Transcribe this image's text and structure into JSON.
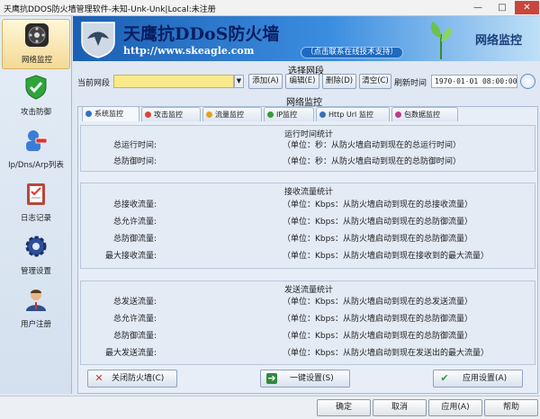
{
  "window": {
    "title": "天鹰抗DDOS防火墙管理软件-未知-Unk-Unk|Local:未注册",
    "min": "—",
    "max": "□",
    "close": "✕"
  },
  "sidebar": {
    "items": [
      {
        "label": "网络监控",
        "icon": "network-monitor-icon"
      },
      {
        "label": "攻击防御",
        "icon": "shield-check-icon"
      },
      {
        "label": "Ip/Dns/Arp列表",
        "icon": "list-user-icon"
      },
      {
        "label": "日志记录",
        "icon": "clipboard-log-icon"
      },
      {
        "label": "管理设置",
        "icon": "gear-icon"
      },
      {
        "label": "用户注册",
        "icon": "user-register-icon"
      }
    ]
  },
  "banner": {
    "name": "天鹰抗DDoS防火墙",
    "url": "http://www.skeagle.com",
    "slogan": "（点击联系在线技术支持）",
    "section": "网络监控"
  },
  "select": {
    "group_title": "选择网段",
    "label": "当前网段",
    "value": "",
    "add": "添加(A)",
    "edit": "编辑(E)",
    "delete": "删除(D)",
    "clear": "清空(C)",
    "refresh_label": "刷新时间",
    "refresh_value": "1970-01-01 08:00:00"
  },
  "monitor": {
    "group_title": "网络监控",
    "tabs": [
      {
        "label": "系统监控",
        "color": "#2f74c8"
      },
      {
        "label": "攻击监控",
        "color": "#d8453a"
      },
      {
        "label": "流量监控",
        "color": "#e6a21a"
      },
      {
        "label": "IP监控",
        "color": "#3a9a3a"
      },
      {
        "label": "Http Url 监控",
        "color": "#3a6fb8"
      },
      {
        "label": "包数据监控",
        "color": "#c23a8a"
      }
    ],
    "runtime": {
      "title": "运行时间统计",
      "rows": [
        {
          "key": "总运行时间:",
          "value": "（单位：秒：从防火墙启动到现在的总运行时间）"
        },
        {
          "key": "总防御时间:",
          "value": "（单位：秒：从防火墙启动到现在的总防御时间）"
        }
      ]
    },
    "receive": {
      "title": "接收流量统计",
      "rows": [
        {
          "key": "总接收流量:",
          "value": "（单位：Kbps：从防火墙启动到现在的总接收流量）"
        },
        {
          "key": "总允许流量:",
          "value": "（单位：Kbps：从防火墙启动到现在的总防御流量）"
        },
        {
          "key": "总防御流量:",
          "value": "（单位：Kbps：从防火墙启动到现在的总防御流量）"
        },
        {
          "key": "最大接收流量:",
          "value": "（单位：Kbps：从防火墙启动到现在接收到的最大流量）"
        }
      ]
    },
    "send": {
      "title": "发送流量统计",
      "rows": [
        {
          "key": "总发送流量:",
          "value": "（单位：Kbps：从防火墙启动到现在的总发送流量）"
        },
        {
          "key": "总允许流量:",
          "value": "（单位：Kbps：从防火墙启动到现在的总防御流量）"
        },
        {
          "key": "总防御流量:",
          "value": "（单位：Kbps：从防火墙启动到现在的总防御流量）"
        },
        {
          "key": "最大发送流量:",
          "value": "（单位：Kbps：从防火墙启动到现在发送出的最大流量）"
        }
      ]
    },
    "actions": {
      "close_fw": "关闭防火墙(C)",
      "one_key": "一键设置(S)",
      "apply": "应用设置(A)"
    }
  },
  "bottom": {
    "ok": "确定",
    "cancel": "取消",
    "apply": "应用(A)",
    "help": "帮助"
  },
  "colors": {
    "accent": "#1b5fb3",
    "input_highlight": "#f8e98a",
    "close_red": "#c9463d"
  }
}
